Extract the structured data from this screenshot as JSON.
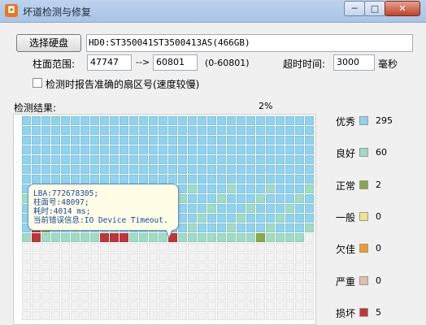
{
  "window": {
    "title": "坏道检测与修复",
    "app_icon_glyph": "◘",
    "min_glyph": "─",
    "max_glyph": "□",
    "close_glyph": "✕"
  },
  "toolbar": {
    "select_disk_label": "选择硬盘",
    "disk_info": "HD0:ST350041ST3500413AS(466GB)",
    "range_label": "柱面范围:",
    "range_from": "47747",
    "range_arrow": "-->",
    "range_to": "60801",
    "range_total": "(0-60801)",
    "timeout_label": "超时时间:",
    "timeout_value": "3000",
    "timeout_unit": "毫秒",
    "report_checkbox_label": "检测时报告准确的扇区号(速度较慢)"
  },
  "progress": {
    "label": "检测结果:",
    "percent_text": "2%"
  },
  "tooltip": {
    "line1": "LBA:772678305;",
    "line2": "柱面号:48097;",
    "line3": "耗时:4014 ms;",
    "line4": "当前错误信息:IO Device Timeout."
  },
  "legend": [
    {
      "label": "优秀",
      "count": "295",
      "color": "#8fd3ef"
    },
    {
      "label": "良好",
      "count": "60",
      "color": "#9fdcc6"
    },
    {
      "label": "正常",
      "count": "2",
      "color": "#8aa84a"
    },
    {
      "label": "一般",
      "count": "0",
      "color": "#f3e38a"
    },
    {
      "label": "欠佳",
      "count": "0",
      "color": "#f19a2a"
    },
    {
      "label": "严重",
      "count": "0",
      "color": "#e0c0a5"
    },
    {
      "label": "损坏",
      "count": "5",
      "color": "#c0353a"
    }
  ],
  "colors": {
    "excellent": "#8fd3ef",
    "good": "#9fdcc6",
    "normal": "#8aa84a",
    "bad": "#c0353a",
    "empty": "#f2f2f2"
  }
}
